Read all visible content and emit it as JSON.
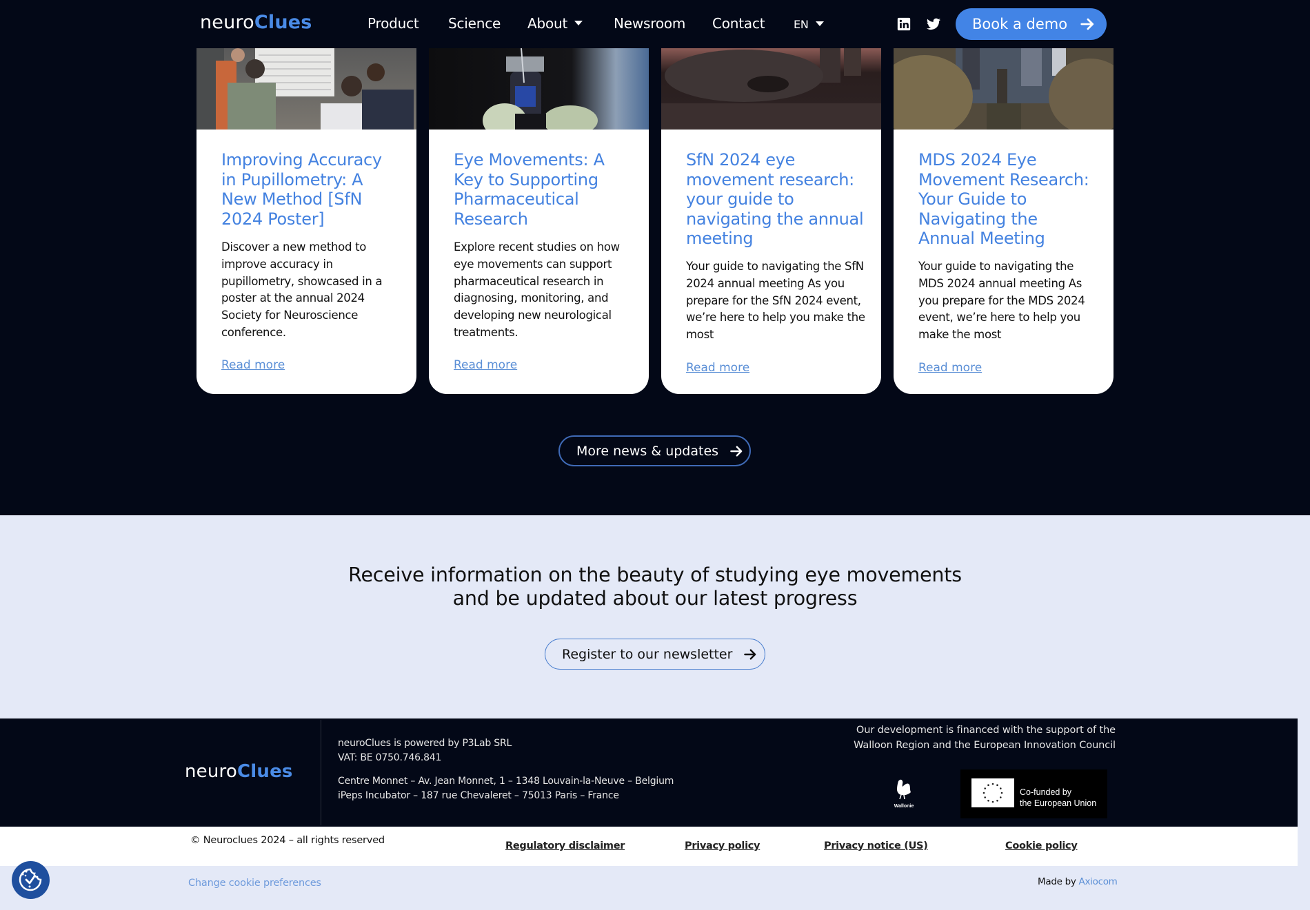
{
  "brand": {
    "logo_part1": "neuro",
    "logo_part2": "Clues",
    "accent_color": "#4284e6",
    "dark_bg": "#030817"
  },
  "nav": {
    "items": [
      {
        "label": "Product",
        "has_dropdown": false
      },
      {
        "label": "Science",
        "has_dropdown": false
      },
      {
        "label": "About",
        "has_dropdown": true
      },
      {
        "label": "Newsroom",
        "has_dropdown": false
      },
      {
        "label": "Contact",
        "has_dropdown": false
      }
    ],
    "language": "EN",
    "social_icons": [
      "linkedin-icon",
      "twitter-icon"
    ],
    "cta_label": "Book a demo"
  },
  "cards": [
    {
      "image": "poster-session-photo",
      "title": "Improving Accuracy in Pupillometry: A New Method [SfN 2024 Poster]",
      "description": "Discover a new method to improve accuracy in pupillometry, showcased in a poster at the annual 2024 Society for Neuroscience conference.",
      "link_label": "Read more"
    },
    {
      "image": "vial-photo",
      "title": "Eye Movements: A Key to Supporting Pharmaceutical Research",
      "description": "Explore recent studies on how eye movements can support pharmaceutical research in diagnosing, monitoring, and developing new neurological treatments.",
      "link_label": "Read more"
    },
    {
      "image": "chicago-bean-photo",
      "title": "SfN 2024 eye movement research: your guide to navigating the annual meeting",
      "description": "Your guide to navigating the SfN 2024 annual meeting As you prepare for the SfN 2024 event, we’re here to help you make the most",
      "link_label": "Read more"
    },
    {
      "image": "philadelphia-parkway-photo",
      "title": "MDS 2024 Eye Movement Research: Your Guide to Navigating the Annual Meeting",
      "description": "Your guide to navigating the MDS 2024 annual meeting As you prepare for the MDS 2024 event, we’re here to help you make the most",
      "link_label": "Read more"
    }
  ],
  "more_news_label": "More news & updates",
  "newsletter": {
    "title_line1": "Receive information on the beauty of studying eye movements",
    "title_line2": "and be updated about our latest progress",
    "button_label": "Register to our newsletter"
  },
  "footer": {
    "company_line1": "neuroClues is powered by P3Lab SRL",
    "company_line2": "VAT: BE 0750.746.841",
    "address_line1": "Centre Monnet – Av. Jean Monnet, 1 – 1348 Louvain-la-Neuve – Belgium",
    "address_line2": "iPeps Incubator – 187 rue Chevaleret – 75013 Paris – France",
    "funding_line1": "Our development is financed with the support of the",
    "funding_line2": "Walloon Region and the European Innovation Council",
    "wallonie_label": "Wallonie",
    "eu_line1": "Co-funded by",
    "eu_line2": "the European Union",
    "copyright": "© Neuroclues 2024 – all rights reserved",
    "legal_links": [
      "Regulatory disclaimer",
      "Privacy policy",
      "Privacy notice (US)",
      "Cookie policy"
    ],
    "cookie_preferences": "Change cookie preferences",
    "made_by_prefix": "Made by",
    "made_by_agency": "Axiocom"
  }
}
